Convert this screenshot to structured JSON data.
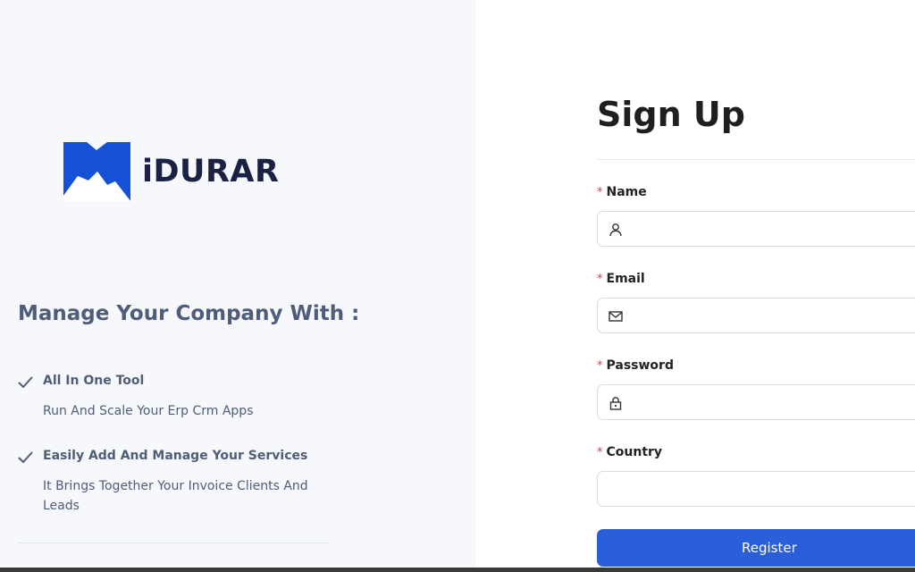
{
  "brand": {
    "logo_text": "iDURAR",
    "logo_color": "#1551d6"
  },
  "left": {
    "tagline": "Manage Your Company With :",
    "features": [
      {
        "icon": "checkmark-icon",
        "title": "All In One Tool",
        "description": "Run And Scale Your Erp Crm Apps"
      },
      {
        "icon": "checkmark-icon",
        "title": "Easily Add And Manage Your Services",
        "description": "It Brings Together Your Invoice Clients And Leads"
      }
    ]
  },
  "form": {
    "title": "Sign Up",
    "required_mark": "*",
    "fields": {
      "name": {
        "label": "Name",
        "icon": "user-icon",
        "value": "",
        "placeholder": ""
      },
      "email": {
        "label": "Email",
        "icon": "mail-icon",
        "value": "",
        "placeholder": ""
      },
      "password": {
        "label": "Password",
        "icon": "lock-icon",
        "value": "",
        "placeholder": ""
      },
      "country": {
        "label": "Country",
        "value": "",
        "placeholder": ""
      }
    },
    "register_label": "Register",
    "accent_color": "#2b5fd9",
    "required_color": "#e8333e"
  }
}
